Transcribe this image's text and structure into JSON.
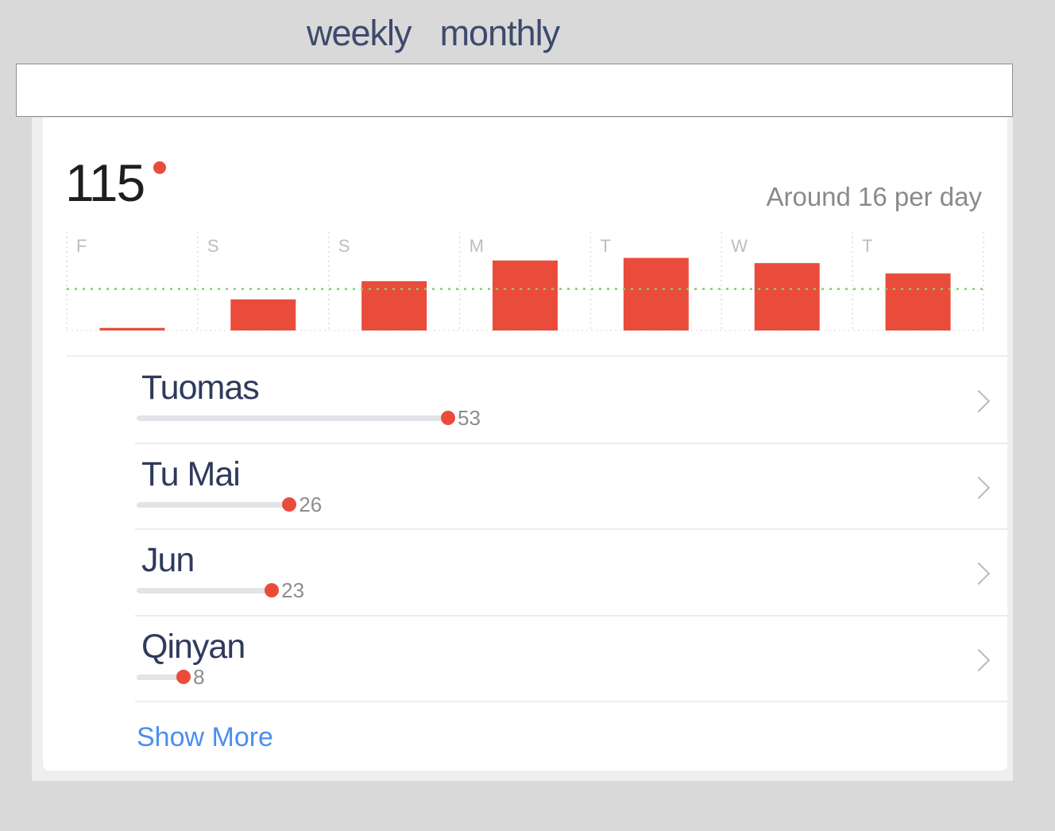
{
  "tabs": [
    {
      "label": "weekly"
    },
    {
      "label": "monthly"
    }
  ],
  "summary": {
    "total": "115",
    "average_label": "Around 16 per day"
  },
  "colors": {
    "bar": "#ea4c3b",
    "average_line": "#7ed06a",
    "accent_link": "#4a8ef0"
  },
  "chart_data": {
    "type": "bar",
    "categories": [
      "F",
      "S",
      "S",
      "M",
      "T",
      "W",
      "T"
    ],
    "values": [
      1,
      12,
      19,
      27,
      28,
      26,
      22
    ],
    "average": 16,
    "ylim": [
      0,
      38
    ],
    "grid": true
  },
  "people": [
    {
      "name": "Tuomas",
      "count": "53",
      "value": 53
    },
    {
      "name": "Tu Mai",
      "count": "26",
      "value": 26
    },
    {
      "name": "Jun",
      "count": "23",
      "value": 23
    },
    {
      "name": "Qinyan",
      "count": "8",
      "value": 8
    }
  ],
  "show_more_label": "Show More"
}
